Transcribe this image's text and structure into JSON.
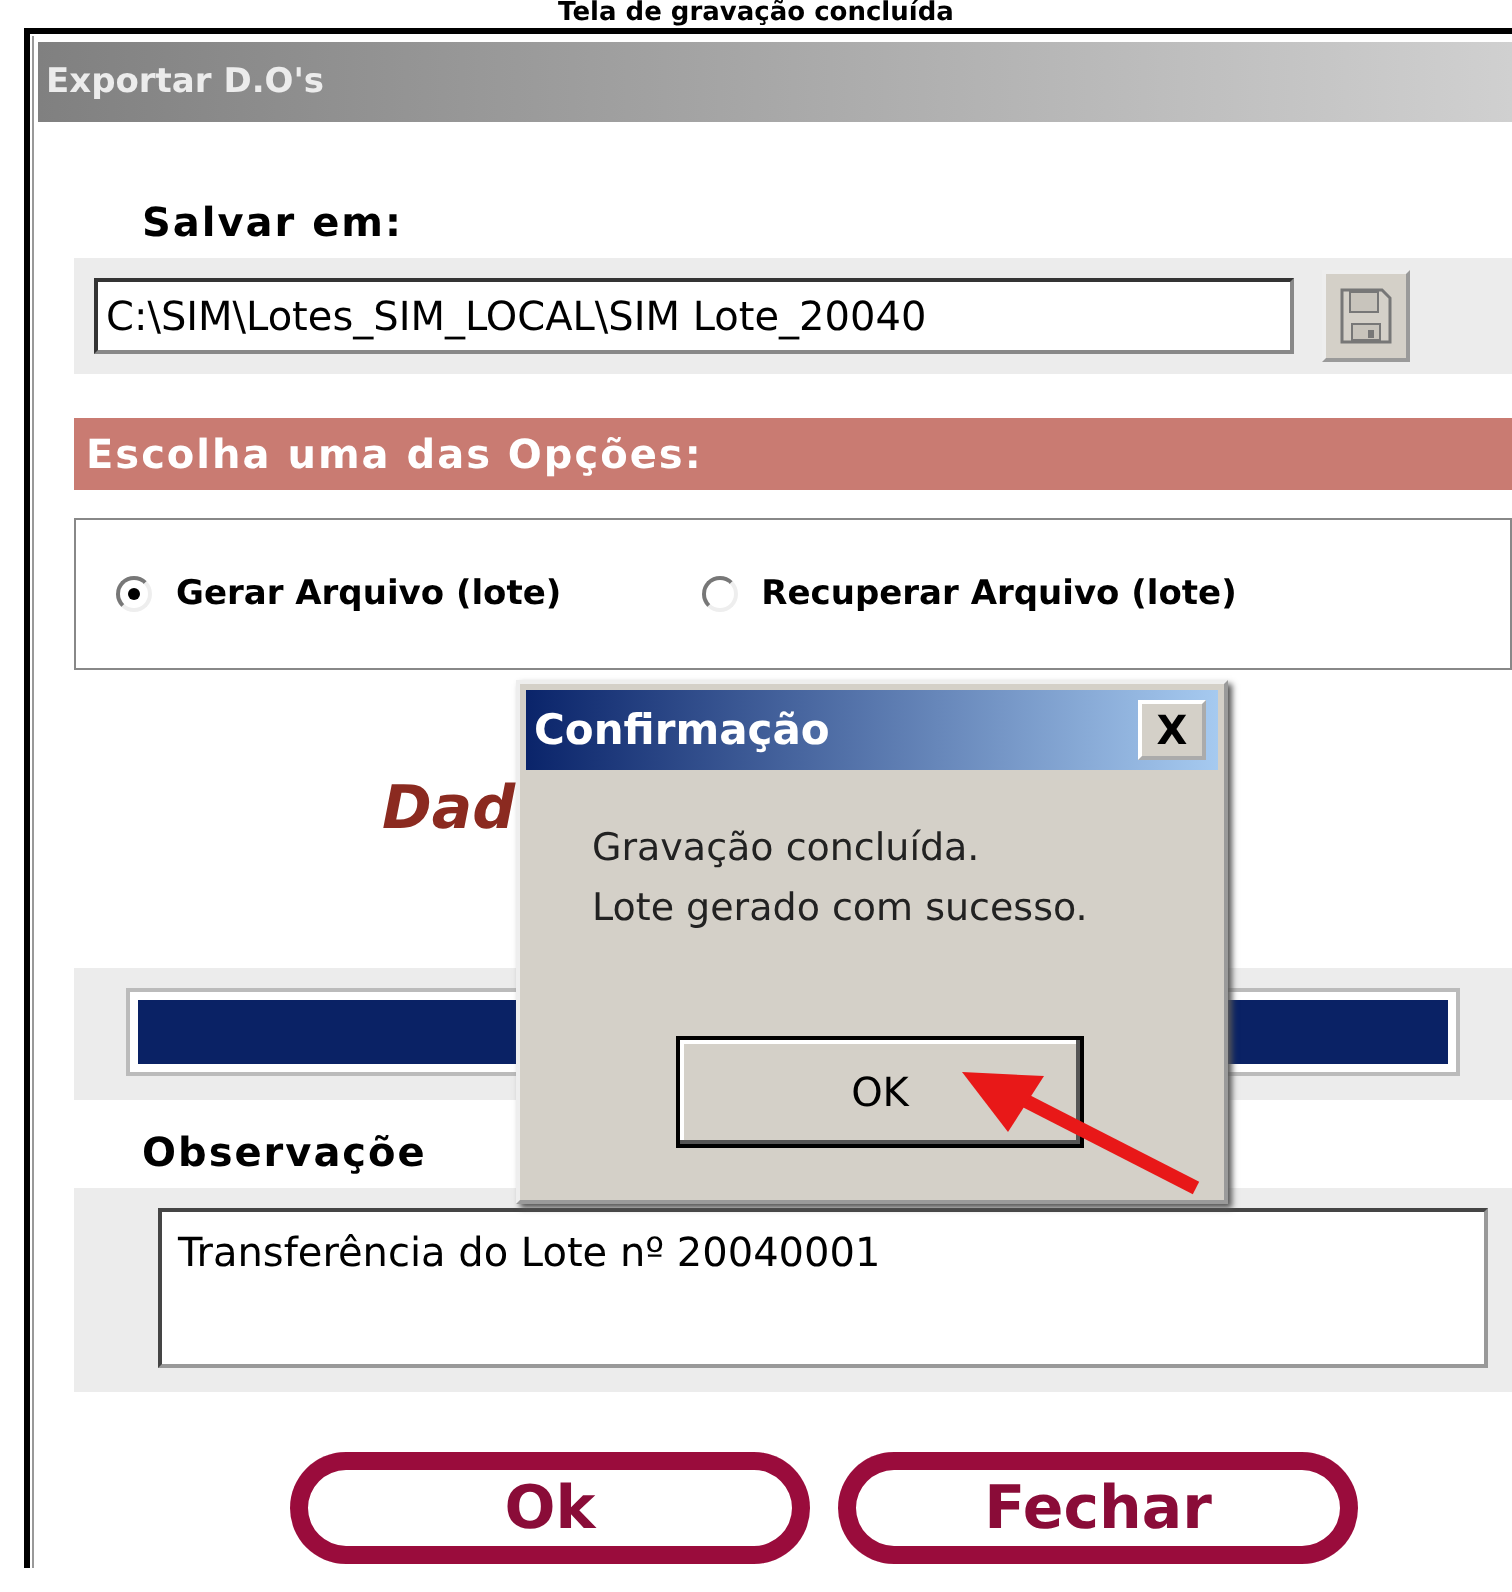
{
  "caption": "Tela de gravação concluída",
  "window": {
    "title": "Exportar D.O's"
  },
  "save_in": {
    "label": "Salvar em:",
    "value": "C:\\SIM\\Lotes_SIM_LOCAL\\SIM Lote_20040"
  },
  "options": {
    "header": "Escolha uma das Opções:",
    "items": [
      {
        "label": "Gerar Arquivo (lote)",
        "selected": true
      },
      {
        "label": "Recuperar Arquivo (lote)",
        "selected": false
      }
    ]
  },
  "status_text": "Dad",
  "progress": {
    "level": 1
  },
  "notes": {
    "label": "Observaçõe",
    "value": "Transferência do Lote nº 20040001"
  },
  "buttons": [
    "Ok",
    "Fechar"
  ],
  "dialog": {
    "title": "Confirmação",
    "close": "X",
    "message": [
      "Gravação concluída.",
      "Lote gerado com sucesso."
    ],
    "button": "OK"
  }
}
